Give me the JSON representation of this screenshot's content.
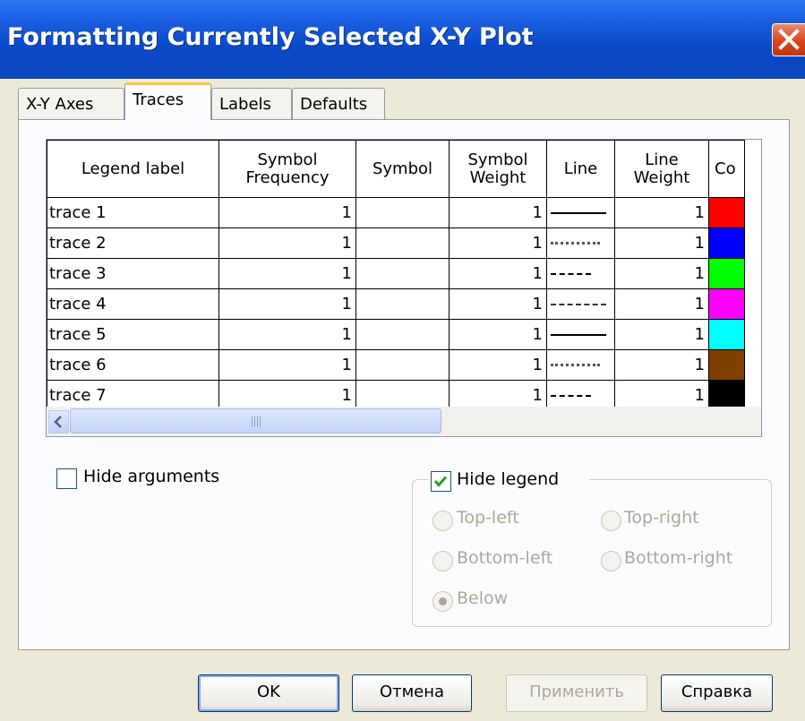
{
  "window": {
    "title": "Formatting Currently Selected X-Y Plot"
  },
  "tabs": [
    {
      "label": "X-Y Axes"
    },
    {
      "label": "Traces"
    },
    {
      "label": "Labels"
    },
    {
      "label": "Defaults"
    }
  ],
  "grid": {
    "headers": {
      "legend_label": "Legend label",
      "symbol_frequency_1": "Symbol",
      "symbol_frequency_2": "Frequency",
      "symbol": "Symbol",
      "symbol_weight_1": "Symbol",
      "symbol_weight_2": "Weight",
      "line": "Line",
      "line_weight_1": "Line",
      "line_weight_2": "Weight",
      "color": "Co"
    },
    "rows": [
      {
        "label": "trace 1",
        "symbol_frequency": "1",
        "symbol": "",
        "symbol_weight": "1",
        "line": "solid",
        "line_weight": "1",
        "color": "#ff0000"
      },
      {
        "label": "trace 2",
        "symbol_frequency": "1",
        "symbol": "",
        "symbol_weight": "1",
        "line": "dotted",
        "line_weight": "1",
        "color": "#0000ff"
      },
      {
        "label": "trace 3",
        "symbol_frequency": "1",
        "symbol": "",
        "symbol_weight": "1",
        "line": "dashed",
        "line_weight": "1",
        "color": "#00ff00"
      },
      {
        "label": "trace 4",
        "symbol_frequency": "1",
        "symbol": "",
        "symbol_weight": "1",
        "line": "dash-dot",
        "line_weight": "1",
        "color": "#ff00ff"
      },
      {
        "label": "trace 5",
        "symbol_frequency": "1",
        "symbol": "",
        "symbol_weight": "1",
        "line": "solid",
        "line_weight": "1",
        "color": "#00ffff"
      },
      {
        "label": "trace 6",
        "symbol_frequency": "1",
        "symbol": "",
        "symbol_weight": "1",
        "line": "dotted",
        "line_weight": "1",
        "color": "#7f3f00"
      },
      {
        "label": "trace 7",
        "symbol_frequency": "1",
        "symbol": "",
        "symbol_weight": "1",
        "line": "dashed",
        "line_weight": "1",
        "color": "#000000"
      }
    ]
  },
  "options": {
    "hide_arguments": {
      "label": "Hide arguments",
      "checked": false
    },
    "hide_legend": {
      "label": "Hide legend",
      "checked": true
    }
  },
  "legend_position": {
    "top_left": "Top-left",
    "top_right": "Top-right",
    "bottom_left": "Bottom-left",
    "bottom_right": "Bottom-right",
    "below": "Below",
    "selected": "Below"
  },
  "buttons": {
    "ok": "OK",
    "cancel": "Отмена",
    "apply": "Применить",
    "help": "Справка"
  }
}
